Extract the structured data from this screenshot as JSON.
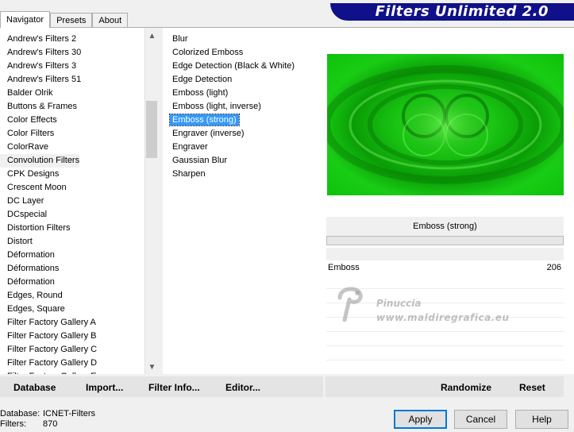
{
  "tabs": [
    "Navigator",
    "Presets",
    "About"
  ],
  "brand_title": "Filters Unlimited 2.0",
  "categories": [
    "Andrew's Filters 2",
    "Andrew's Filters 30",
    "Andrew's Filters 3",
    "Andrew's Filters 51",
    "Balder Olrik",
    "Buttons & Frames",
    "Color Effects",
    "Color Filters",
    "ColorRave",
    "Convolution Filters",
    "CPK Designs",
    "Crescent Moon",
    "DC Layer",
    "DCspecial",
    "Distortion Filters",
    "Distort",
    "Déformation",
    "Déformations",
    "Déformation",
    "Edges, Round",
    "Edges, Square",
    "Filter Factory Gallery A",
    "Filter Factory Gallery B",
    "Filter Factory Gallery C",
    "Filter Factory Gallery D",
    "Filter Factory Gallery E"
  ],
  "selected_category": "Convolution Filters",
  "filters": [
    "Blur",
    "Colorized Emboss",
    "Edge Detection (Black & White)",
    "Edge Detection",
    "Emboss (light)",
    "Emboss (light, inverse)",
    "Emboss (strong)",
    "Engraver (inverse)",
    "Engraver",
    "Gaussian Blur",
    "Sharpen"
  ],
  "selected_filter": "Emboss (strong)",
  "preview_filter_name": "Emboss (strong)",
  "parameter": {
    "label": "Emboss",
    "value": "206"
  },
  "watermark": {
    "name": "Pinuccia",
    "site": "www.maldiregrafica.eu"
  },
  "bottom_buttons": {
    "database": "Database",
    "import": "Import...",
    "filter_info": "Filter Info...",
    "editor": "Editor...",
    "randomize": "Randomize",
    "reset": "Reset"
  },
  "status": {
    "database_label": "Database:",
    "database_value": "ICNET-Filters",
    "filters_label": "Filters:",
    "filters_value": "870"
  },
  "dialog_buttons": {
    "apply": "Apply",
    "cancel": "Cancel",
    "help": "Help"
  },
  "colors": {
    "brand": "#10108a",
    "selection": "#3399ff",
    "preview_green": "#19c412"
  },
  "scroll_icons": {
    "up": "chevron-up-icon",
    "down": "chevron-down-icon"
  }
}
